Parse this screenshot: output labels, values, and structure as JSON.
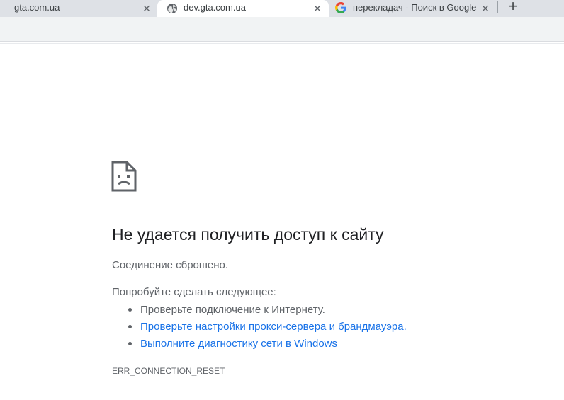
{
  "tabs": [
    {
      "title": "gta.com.ua",
      "close": "✕"
    },
    {
      "title": "dev.gta.com.ua",
      "close": "✕"
    },
    {
      "title": "перекладач - Поиск в Google",
      "close": "✕"
    }
  ],
  "new_tab": "+",
  "error": {
    "icon": "sad-page-icon",
    "title": "Не удается получить доступ к сайту",
    "summary": "Соединение сброшено.",
    "suggestions_heading": "Попробуйте сделать следующее:",
    "suggestions": [
      {
        "text": "Проверьте подключение к Интернету."
      },
      {
        "text": "Проверьте настройки прокси-сервера и брандмауэра."
      },
      {
        "text": "Выполните диагностику сети в Windows"
      }
    ],
    "code": "ERR_CONNECTION_RESET"
  },
  "colors": {
    "link": "#1a73e8",
    "text": "#5f6368",
    "heading": "#202124",
    "tabstrip": "#dee1e6"
  }
}
